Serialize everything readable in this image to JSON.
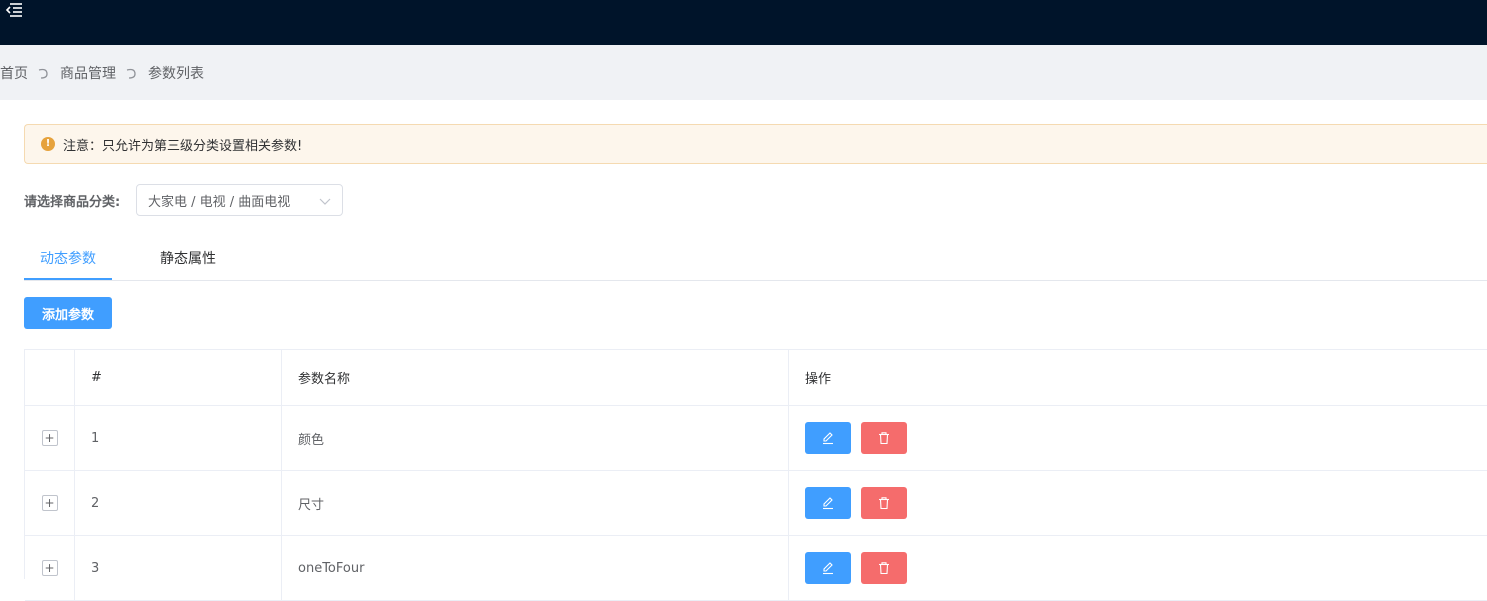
{
  "header": {
    "menu_icon": "menu-fold-icon",
    "background": "#00142a"
  },
  "breadcrumb": {
    "items": [
      "首页",
      "商品管理",
      "参数列表"
    ],
    "separator_icon": "curved-arrow-icon"
  },
  "alert": {
    "icon": "warning-circle-icon",
    "text": "注意：只允许为第三级分类设置相关参数!",
    "color": "#e6a23c"
  },
  "category": {
    "label": "请选择商品分类:",
    "value": "大家电 / 电视 / 曲面电视",
    "arrow_icon": "chevron-down-icon"
  },
  "tabs": {
    "items": [
      {
        "label": "动态参数",
        "active": true
      },
      {
        "label": "静态属性",
        "active": false
      }
    ],
    "accent": "#409eff"
  },
  "toolbar": {
    "add_label": "添加参数"
  },
  "table": {
    "headers": [
      "",
      "#",
      "参数名称",
      "操作"
    ],
    "rows": [
      {
        "index": "1",
        "name": "颜色"
      },
      {
        "index": "2",
        "name": "尺寸"
      },
      {
        "index": "3",
        "name": "oneToFour"
      }
    ],
    "expand_symbol": "+",
    "edit_icon": "edit-icon",
    "delete_icon": "trash-icon",
    "edit_color": "#409eff",
    "delete_color": "#f56c6c"
  }
}
